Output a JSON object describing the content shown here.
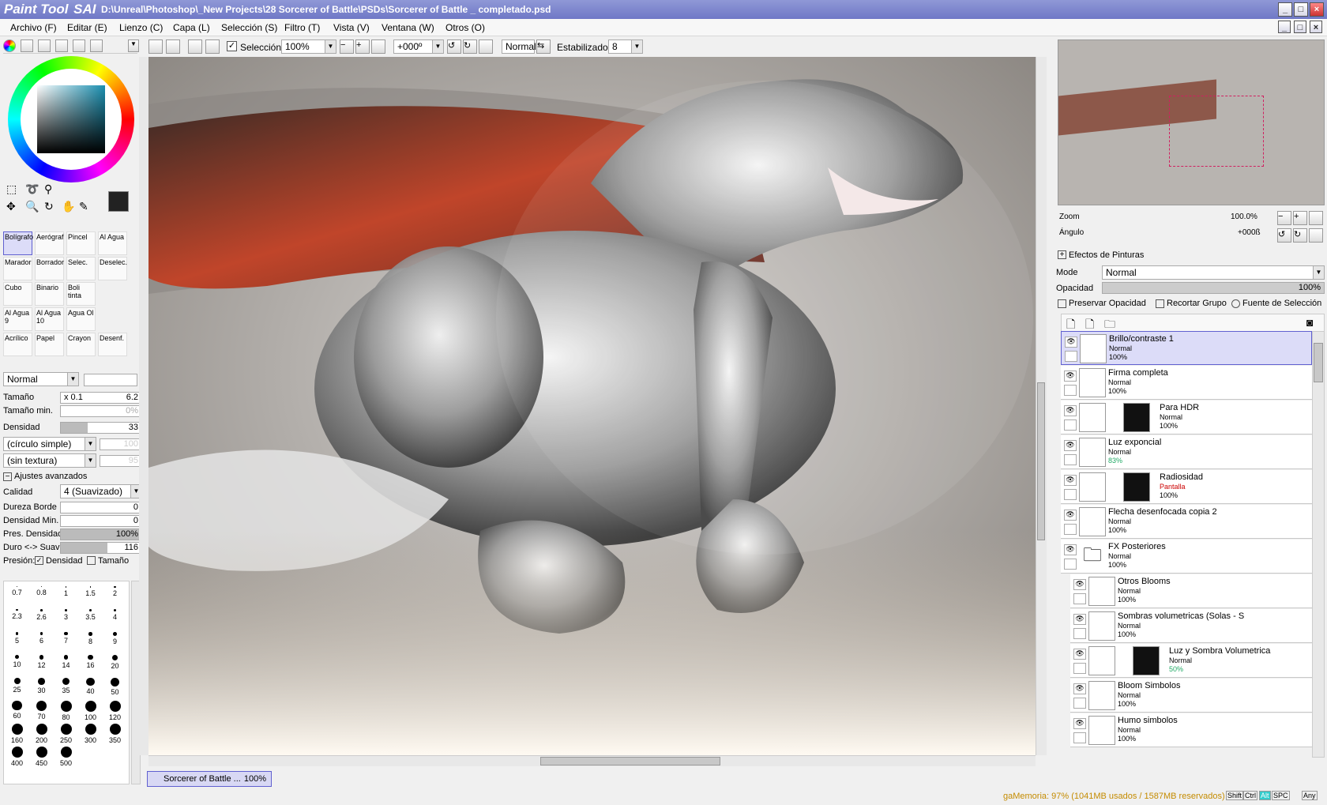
{
  "window": {
    "app_name": "Paint Tool",
    "app_sai": "SAI",
    "title": "D:\\Unreal\\Photoshop\\_New Projects\\28 Sorcerer of Battle\\PSDs\\Sorcerer of Battle _ completado.psd"
  },
  "menu": [
    "Archivo (F)",
    "Editar (E)",
    "Lienzo (C)",
    "Capa (L)",
    "Selección (S)",
    "Filtro (T)",
    "Vista (V)",
    "Ventana (W)",
    "Otros (O)"
  ],
  "toolbar": {
    "seleccion": "Selección",
    "zoom": "100%",
    "angle": "+000º",
    "mode": "Normal",
    "stab_label": "Estabilizador",
    "stab_value": "8"
  },
  "left": {
    "tools": [
      [
        "Bolígrafo",
        "Aerógraf",
        "Pincel",
        "Al Agua"
      ],
      [
        "Marador",
        "Borrador",
        "Selec.",
        "Deselec."
      ],
      [
        "Cubo",
        "Binario",
        "Boli tinta",
        ""
      ],
      [
        "Al Agua 9",
        "Al Agua 10",
        "Agua Ol",
        ""
      ],
      [
        "Acrílico",
        "Papel",
        "Crayon",
        "Desenf."
      ]
    ],
    "blend": "Normal",
    "size_label": "Tamaño",
    "size_mult": "x 0.1",
    "size_value": "6.2",
    "min_label": "Tamaño min.",
    "min_value": "0%",
    "dens_label": "Densidad",
    "dens_value": "33",
    "shape": "(círculo simple)",
    "shape_val": "100",
    "texture": "(sin textura)",
    "texture_val": "95",
    "adv": "Ajustes avanzados",
    "quality_label": "Calidad",
    "quality": "4 (Suavizado)",
    "edge_label": "Dureza Borde",
    "edge": "0",
    "dmin_label": "Densidad Min.",
    "dmin": "0",
    "pdens_label": "Pres. Densidad",
    "pdens": "100%",
    "hs_label": "Duro <-> Suave",
    "hs": "116",
    "pres_label": "Presión:",
    "pres_d": "Densidad",
    "pres_t": "Tamaño",
    "brushes": [
      "0.7",
      "0.8",
      "1",
      "1.5",
      "2",
      "2.3",
      "2.6",
      "3",
      "3.5",
      "4",
      "5",
      "6",
      "7",
      "8",
      "9",
      "10",
      "12",
      "14",
      "16",
      "20",
      "25",
      "30",
      "35",
      "40",
      "50",
      "60",
      "70",
      "80",
      "100",
      "120",
      "160",
      "200",
      "250",
      "300",
      "350",
      "400",
      "450",
      "500"
    ]
  },
  "canvas_tab": {
    "name": "Sorcerer of Battle ...",
    "zoom": "100%"
  },
  "right": {
    "zoom_label": "Zoom",
    "zoom": "100.0%",
    "angle_label": "Ángulo",
    "angle": "+000ß",
    "effects": "Efectos de Pinturas",
    "mode_label": "Mode",
    "mode": "Normal",
    "opacity_label": "Opacidad",
    "opacity": "100%",
    "preserve": "Preservar Opacidad",
    "clip": "Recortar Grupo",
    "source": "Fuente de Selección",
    "layers": [
      {
        "name": "Brillo/contraste 1",
        "mode": "Normal",
        "opacity": "100%"
      },
      {
        "name": "Firma completa",
        "mode": "Normal",
        "opacity": "100%"
      },
      {
        "name": "Para HDR",
        "mode": "Normal",
        "opacity": "100%"
      },
      {
        "name": "Luz exponcial",
        "mode": "Normal",
        "opacity": "83%"
      },
      {
        "name": "Radiosidad",
        "mode": "Pantalla",
        "opacity": "100%"
      },
      {
        "name": "Flecha desenfocada copia 2",
        "mode": "Normal",
        "opacity": "100%"
      },
      {
        "name": "FX Posteriores",
        "mode": "Normal",
        "opacity": "100%"
      },
      {
        "name": "Otros Blooms",
        "mode": "Normal",
        "opacity": "100%"
      },
      {
        "name": "Sombras volumetricas (Solas - S",
        "mode": "Normal",
        "opacity": "100%"
      },
      {
        "name": "Luz y Sombra Volumetrica",
        "mode": "Normal",
        "opacity": "50%"
      },
      {
        "name": "Bloom Simbolos",
        "mode": "Normal",
        "opacity": "100%"
      },
      {
        "name": "Humo simbolos",
        "mode": "Normal",
        "opacity": "100%"
      }
    ]
  },
  "status": {
    "memory": "gaMemoria: 97% (1041MB usados / 1587MB reservados)",
    "keys": [
      "Shift",
      "Ctrl",
      "Alt",
      "SPC",
      "Any"
    ]
  },
  "colors": {
    "title": "#7f88ce",
    "accent": "#6060d0"
  }
}
